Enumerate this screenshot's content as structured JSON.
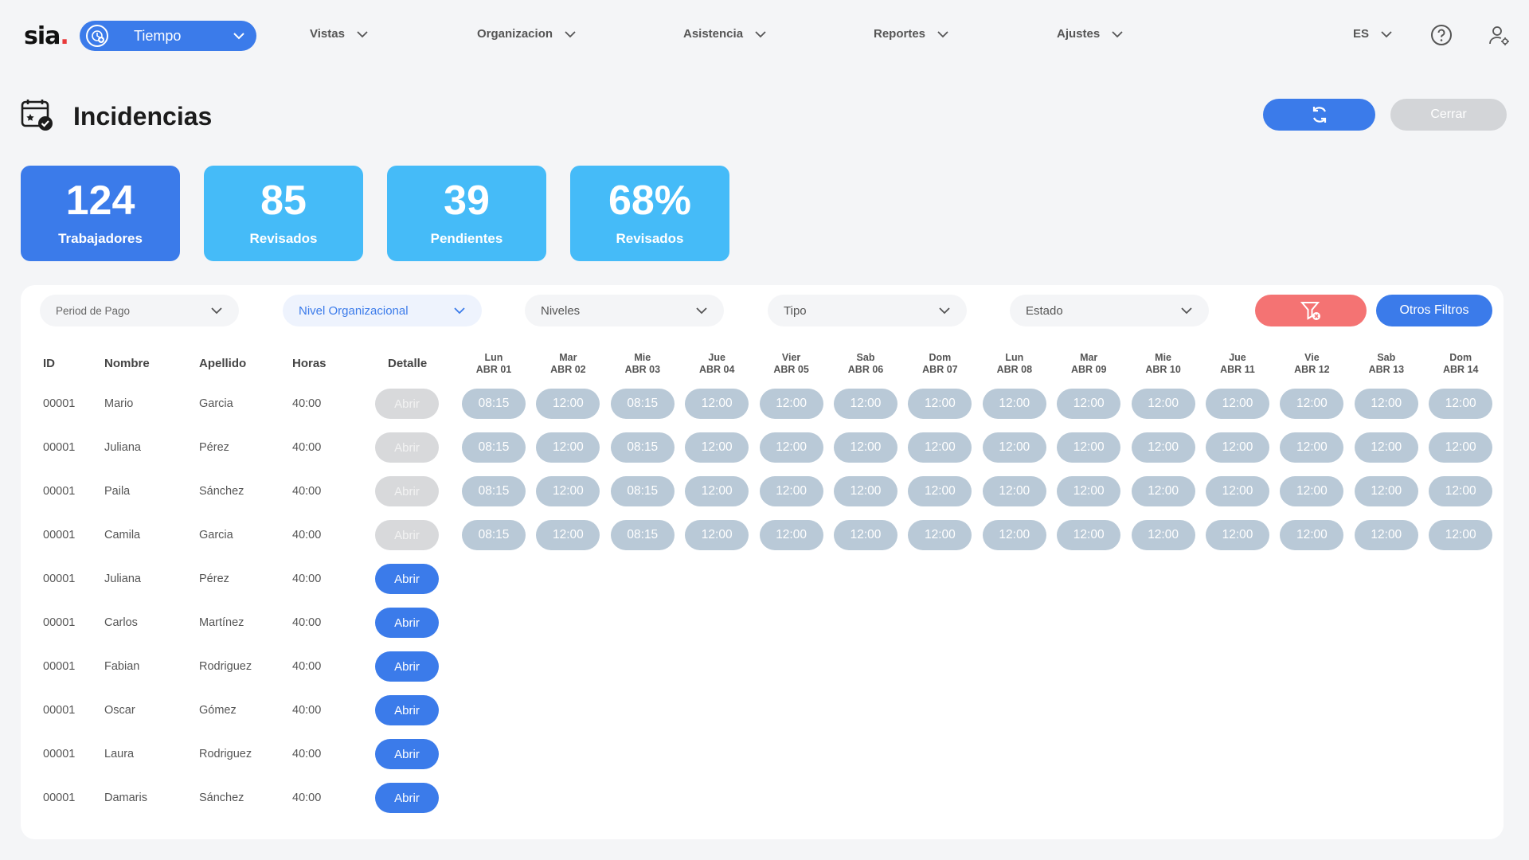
{
  "nav": {
    "logo": "sia",
    "logo_dot": ".",
    "module": "Tiempo",
    "menu": [
      "Vistas",
      "Organizacion",
      "Asistencia",
      "Reportes",
      "Ajustes"
    ],
    "language": "ES"
  },
  "header": {
    "title": "Incidencias",
    "close_label": "Cerrar"
  },
  "stats": [
    {
      "value": "124",
      "label": "Trabajadores",
      "color": "#3b7bea"
    },
    {
      "value": "85",
      "label": "Revisados",
      "color": "#45bbf8"
    },
    {
      "value": "39",
      "label": "Pendientes",
      "color": "#45bbf8"
    },
    {
      "value": "68%",
      "label": "Revisados",
      "color": "#45bbf8"
    }
  ],
  "filters": [
    "Period de Pago",
    "Nivel Organizacional",
    "Niveles",
    "Tipo",
    "Estado"
  ],
  "other_filters_label": "Otros Filtros",
  "table": {
    "headers": {
      "id": "ID",
      "nombre": "Nombre",
      "apellido": "Apellido",
      "horas": "Horas",
      "detalle": "Detalle"
    },
    "days": [
      [
        "Lun",
        "ABR 01"
      ],
      [
        "Mar",
        "ABR 02"
      ],
      [
        "Mie",
        "ABR 03"
      ],
      [
        "Jue",
        "ABR 04"
      ],
      [
        "Vier",
        "ABR 05"
      ],
      [
        "Sab",
        "ABR 06"
      ],
      [
        "Dom",
        "ABR 07"
      ],
      [
        "Lun",
        "ABR 08"
      ],
      [
        "Mar",
        "ABR 09"
      ],
      [
        "Mie",
        "ABR 10"
      ],
      [
        "Jue",
        "ABR 11"
      ],
      [
        "Vie",
        "ABR 12"
      ],
      [
        "Sab",
        "ABR 13"
      ],
      [
        "Dom",
        "ABR 14"
      ]
    ],
    "open_label": "Abrir",
    "rows": [
      {
        "id": "00001",
        "nombre": "Mario",
        "apellido": "Garcia",
        "horas": "40:00",
        "enabled": false,
        "times": [
          "08:15",
          "12:00",
          "08:15",
          "12:00",
          "12:00",
          "12:00",
          "12:00",
          "12:00",
          "12:00",
          "12:00",
          "12:00",
          "12:00",
          "12:00",
          "12:00"
        ]
      },
      {
        "id": "00001",
        "nombre": "Juliana",
        "apellido": "Pérez",
        "horas": "40:00",
        "enabled": false,
        "times": [
          "08:15",
          "12:00",
          "08:15",
          "12:00",
          "12:00",
          "12:00",
          "12:00",
          "12:00",
          "12:00",
          "12:00",
          "12:00",
          "12:00",
          "12:00",
          "12:00"
        ]
      },
      {
        "id": "00001",
        "nombre": "Paila",
        "apellido": "Sánchez",
        "horas": "40:00",
        "enabled": false,
        "times": [
          "08:15",
          "12:00",
          "08:15",
          "12:00",
          "12:00",
          "12:00",
          "12:00",
          "12:00",
          "12:00",
          "12:00",
          "12:00",
          "12:00",
          "12:00",
          "12:00"
        ]
      },
      {
        "id": "00001",
        "nombre": "Camila",
        "apellido": "Garcia",
        "horas": "40:00",
        "enabled": false,
        "times": [
          "08:15",
          "12:00",
          "08:15",
          "12:00",
          "12:00",
          "12:00",
          "12:00",
          "12:00",
          "12:00",
          "12:00",
          "12:00",
          "12:00",
          "12:00",
          "12:00"
        ]
      },
      {
        "id": "00001",
        "nombre": "Juliana",
        "apellido": "Pérez",
        "horas": "40:00",
        "enabled": true,
        "times": []
      },
      {
        "id": "00001",
        "nombre": "Carlos",
        "apellido": "Martínez",
        "horas": "40:00",
        "enabled": true,
        "times": []
      },
      {
        "id": "00001",
        "nombre": "Fabian",
        "apellido": "Rodriguez",
        "horas": "40:00",
        "enabled": true,
        "times": []
      },
      {
        "id": "00001",
        "nombre": "Oscar",
        "apellido": "Gómez",
        "horas": "40:00",
        "enabled": true,
        "times": []
      },
      {
        "id": "00001",
        "nombre": "Laura",
        "apellido": "Rodriguez",
        "horas": "40:00",
        "enabled": true,
        "times": []
      },
      {
        "id": "00001",
        "nombre": "Damaris",
        "apellido": "Sánchez",
        "horas": "40:00",
        "enabled": true,
        "times": []
      }
    ]
  },
  "icons": {
    "module": "clock-plus-icon",
    "help": "help-circle-icon",
    "user_settings": "user-gear-icon",
    "refresh": "refresh-icon",
    "clear_filter": "filter-clear-icon",
    "page": "calendar-check-icon"
  }
}
